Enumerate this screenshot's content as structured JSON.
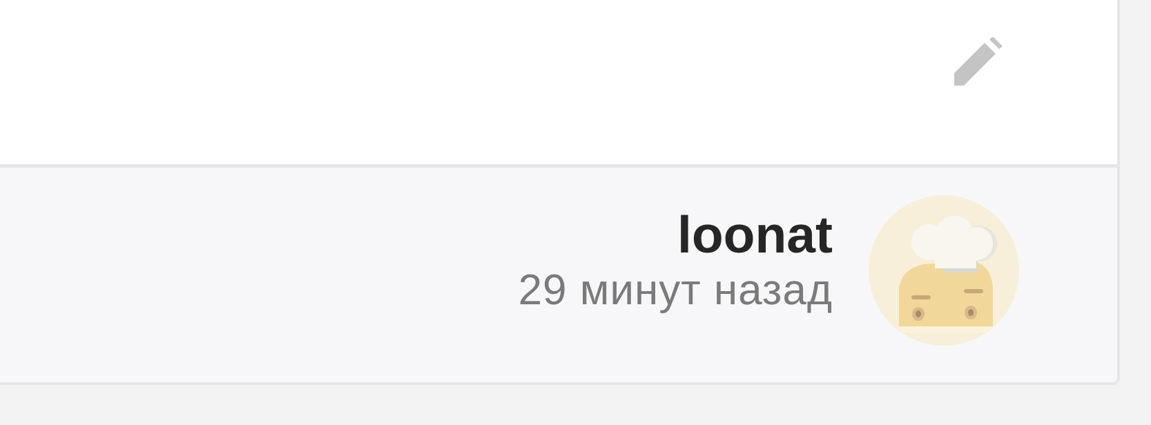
{
  "comment": {
    "author": "loonat",
    "timestamp": "29 минут назад"
  },
  "icons": {
    "edit": "pencil-icon",
    "avatar": "chef-toaster-avatar"
  },
  "colors": {
    "background": "#f3f3f3",
    "card": "#ffffff",
    "footer": "#f7f7f9",
    "border": "#e6e6e9",
    "author": "#262626",
    "timestamp": "#7a7a7a",
    "icon": "#c4c4c4"
  }
}
